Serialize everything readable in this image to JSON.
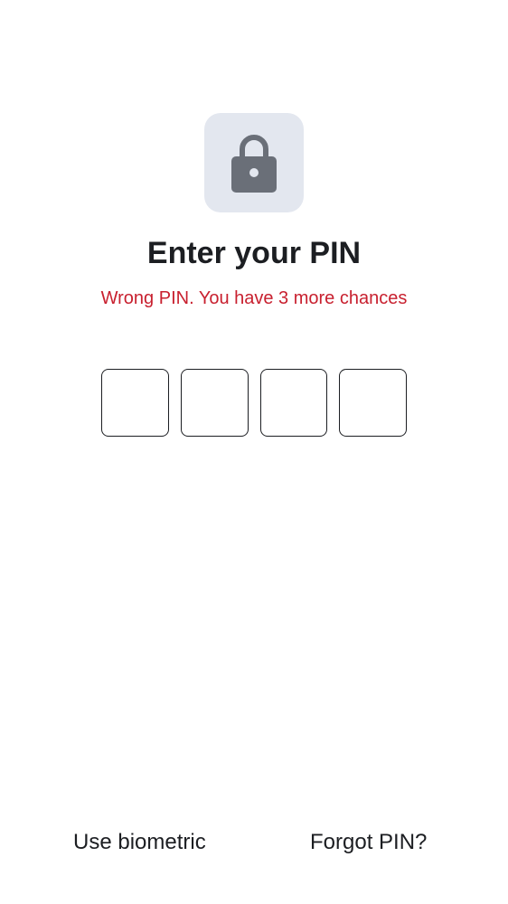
{
  "lock": {
    "icon": "lock-icon",
    "tile_color": "#e3e7ef",
    "icon_color": "#6a6f78"
  },
  "title": "Enter your PIN",
  "error": {
    "text": "Wrong PIN. You have 3 more chances",
    "color": "#c8202f"
  },
  "pin": {
    "length": 4,
    "digits": [
      "",
      "",
      "",
      ""
    ]
  },
  "actions": {
    "biometric_label": "Use biometric",
    "forgot_label": "Forgot PIN?"
  }
}
